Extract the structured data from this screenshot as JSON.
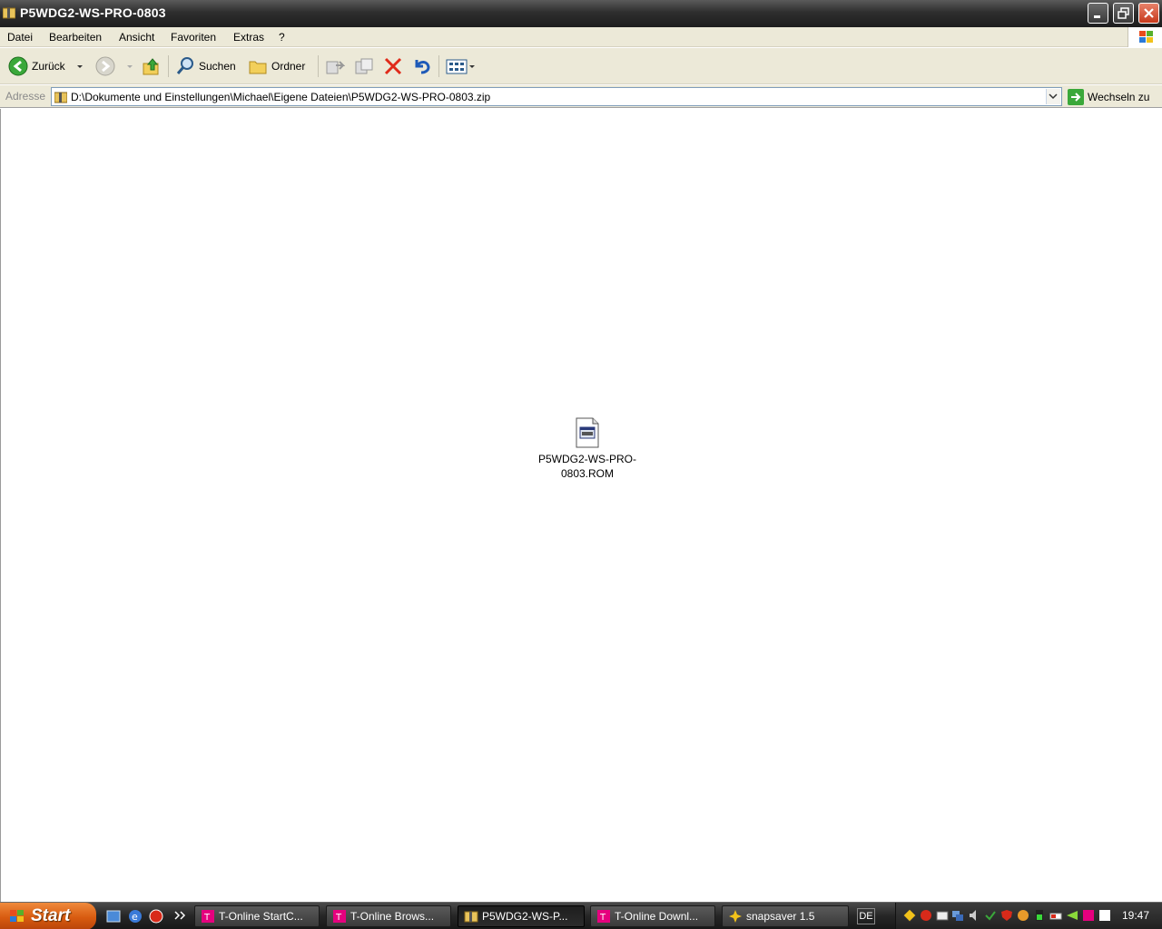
{
  "window": {
    "title": "P5WDG2-WS-PRO-0803"
  },
  "menu": [
    "Datei",
    "Bearbeiten",
    "Ansicht",
    "Favoriten",
    "Extras",
    "?"
  ],
  "toolbar": {
    "back_label": "Zurück",
    "search_label": "Suchen",
    "folders_label": "Ordner"
  },
  "address": {
    "label": "Adresse",
    "path": "D:\\Dokumente und Einstellungen\\Michael\\Eigene Dateien\\P5WDG2-WS-PRO-0803.zip",
    "go_label": "Wechseln zu"
  },
  "files": [
    {
      "name_line1": "P5WDG2-WS-PRO-",
      "name_line2": "0803.ROM",
      "icon": "rom-file-icon"
    }
  ],
  "taskbar": {
    "start_label": "Start",
    "tasks": [
      {
        "label": "T-Online StartC...",
        "icon": "t-online-icon",
        "active": false
      },
      {
        "label": "T-Online Brows...",
        "icon": "t-online-icon",
        "active": false
      },
      {
        "label": "P5WDG2-WS-P...",
        "icon": "zip-folder-icon",
        "active": true
      },
      {
        "label": "T-Online Downl...",
        "icon": "t-online-icon",
        "active": false
      },
      {
        "label": "snapsaver 1.5",
        "icon": "snapsaver-icon",
        "active": false
      }
    ],
    "language": "DE",
    "clock": "19:47"
  },
  "colors": {
    "accent_start": "#d85b10",
    "titlebar": "#2e2e2e",
    "menu_bg": "#ece9d8",
    "close_red": "#c7391c"
  }
}
